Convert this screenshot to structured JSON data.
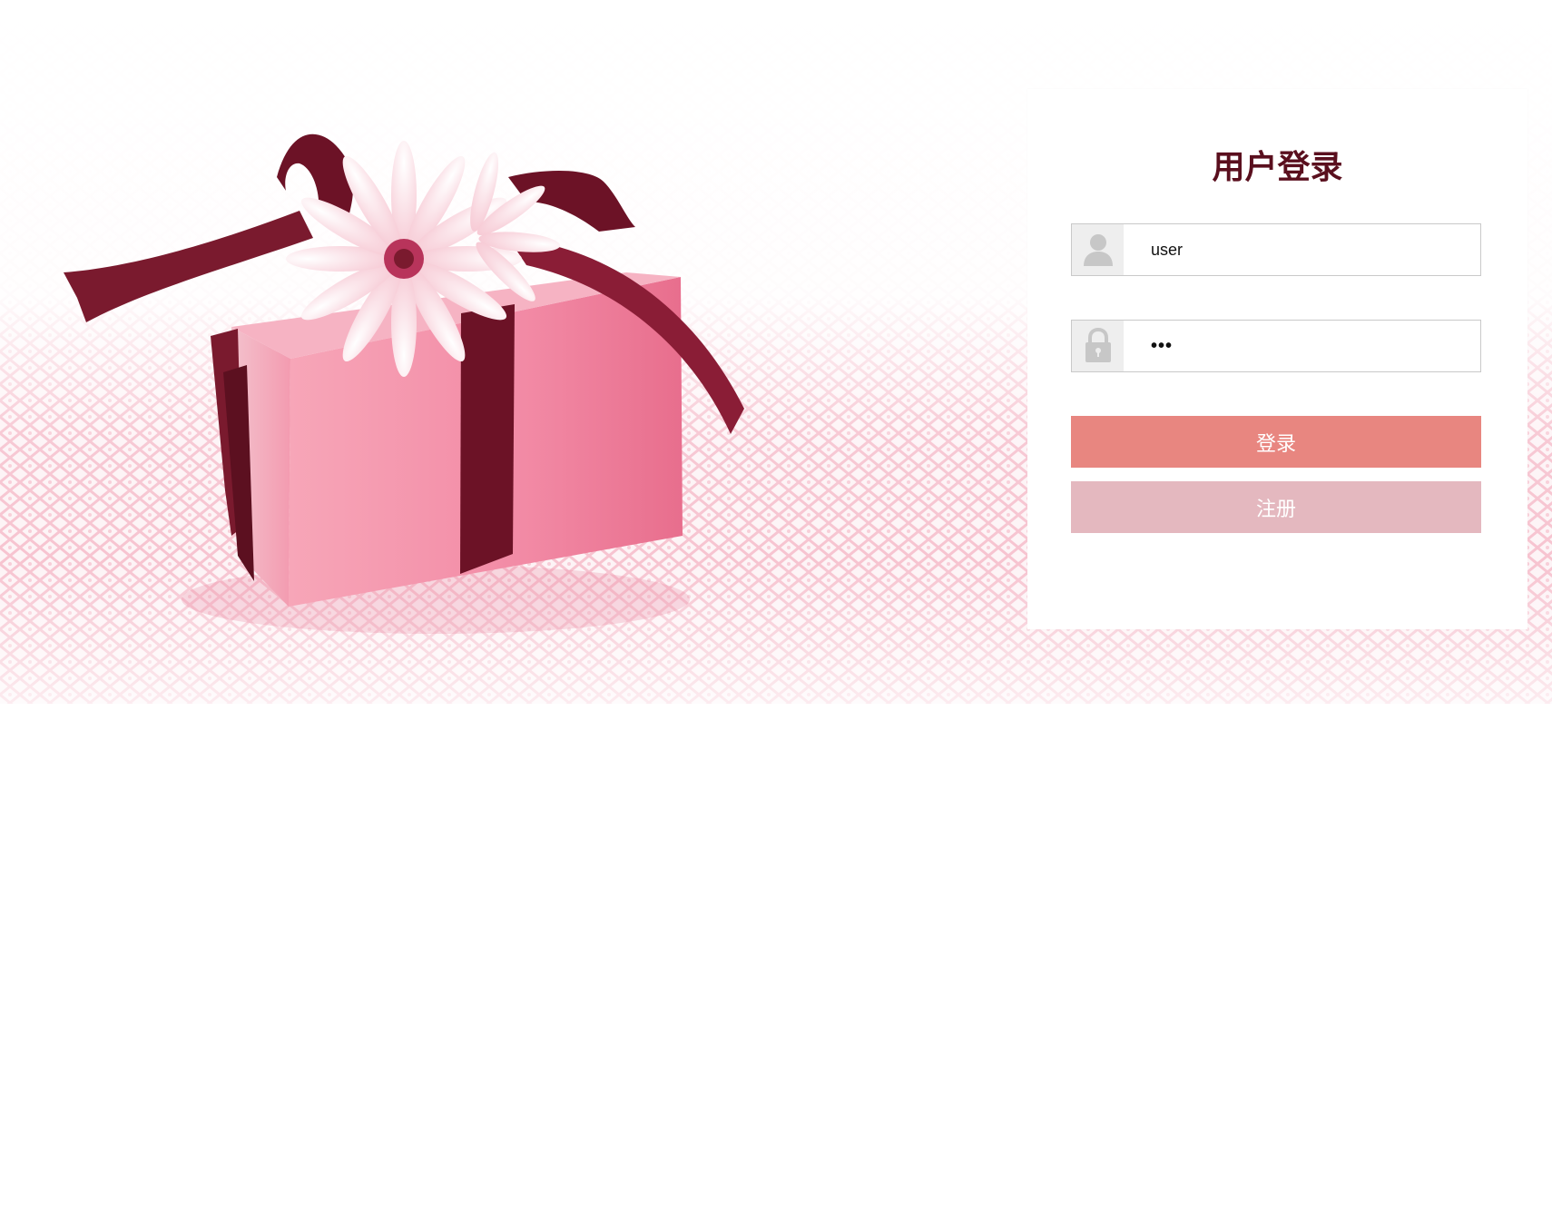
{
  "login": {
    "title": "用户登录",
    "username_value": "user",
    "password_value": "•••",
    "login_label": "登录",
    "register_label": "注册"
  },
  "icons": {
    "username": "user-icon",
    "password": "lock-icon"
  },
  "colors": {
    "title": "#5a0f1e",
    "login_button": "#e88680",
    "register_button": "#e4b8bf",
    "ribbon": "#7a1a2e",
    "box": "#f28aa5"
  }
}
